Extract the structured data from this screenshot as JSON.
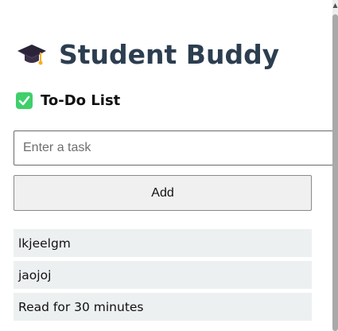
{
  "app": {
    "title": "Student Buddy",
    "title_icon": "graduation-cap-icon"
  },
  "todo": {
    "section_title": "To-Do List",
    "section_icon": "check-mark-button-icon",
    "input_value": "",
    "input_placeholder": "Enter a task",
    "add_label": "Add",
    "tasks": [
      {
        "text": "lkjeelgm"
      },
      {
        "text": "jaojoj"
      },
      {
        "text": "Read for 30 minutes"
      }
    ]
  },
  "colors": {
    "title": "#2c3e50",
    "task_background": "#ecf0f1",
    "check_icon": "#34c759"
  }
}
